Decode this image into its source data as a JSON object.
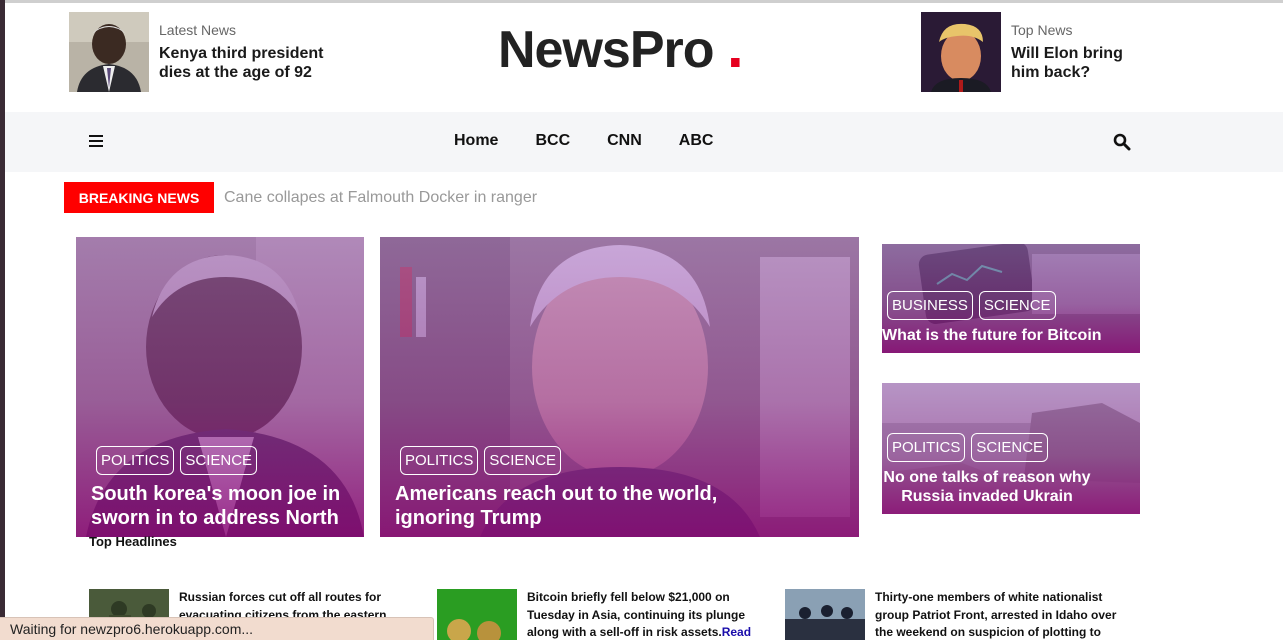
{
  "header": {
    "left_teaser": {
      "kicker": "Latest News",
      "headline_line1": "Kenya third president",
      "headline_line2": "dies at the age of 92"
    },
    "logo": {
      "text": "NewsPro",
      "dot": "."
    },
    "right_teaser": {
      "kicker": "Top News",
      "headline_line1": "Will Elon bring",
      "headline_line2": "him back?"
    }
  },
  "nav": {
    "links": [
      "Home",
      "BCC",
      "CNN",
      "ABC"
    ],
    "menu_icon": "hamburger-icon",
    "search_icon": "search-icon"
  },
  "breaking": {
    "label": "BREAKING NEWS",
    "text": "Cane collapes at Falmouth Docker in ranger"
  },
  "featured": [
    {
      "tags": [
        "POLITICS",
        "SCIENCE"
      ],
      "title_line1": "South korea's moon joe in",
      "title_line2": "sworn in to address North"
    },
    {
      "tags": [
        "POLITICS",
        "SCIENCE"
      ],
      "title_line1": "Americans reach out to the world,",
      "title_line2": "ignoring Trump"
    },
    {
      "tags": [
        "BUSINESS",
        "SCIENCE"
      ],
      "title_line1": "What is the future for Bitcoin",
      "title_line2": ""
    },
    {
      "tags": [
        "POLITICS",
        "SCIENCE"
      ],
      "title_line1": "No one talks of reason why",
      "title_line2": "Russia invaded Ukrain"
    }
  ],
  "top_headlines": {
    "label": "Top Headlines",
    "items": [
      {
        "line1": "Russian forces cut off all routes for",
        "line2": "evacuating citizens from the eastern",
        "read": ""
      },
      {
        "line1": "Bitcoin briefly fell below $21,000 on",
        "line2": "Tuesday in Asia, continuing its plunge",
        "line3": "along with a sell-off in risk assets.",
        "read": "Read"
      },
      {
        "line1": "Thirty-one members of white nationalist",
        "line2": "group Patriot Front, arrested in Idaho over",
        "line3": "the weekend on suspicion of plotting to",
        "read": ""
      }
    ]
  },
  "status_bar": {
    "text": "Waiting for newzpro6.herokuapp.com..."
  },
  "colors": {
    "accent_red": "#ff0000",
    "logo_dot": "#e6001f",
    "overlay_purple": "#8c0a78",
    "link_blue": "#1a0dab"
  }
}
